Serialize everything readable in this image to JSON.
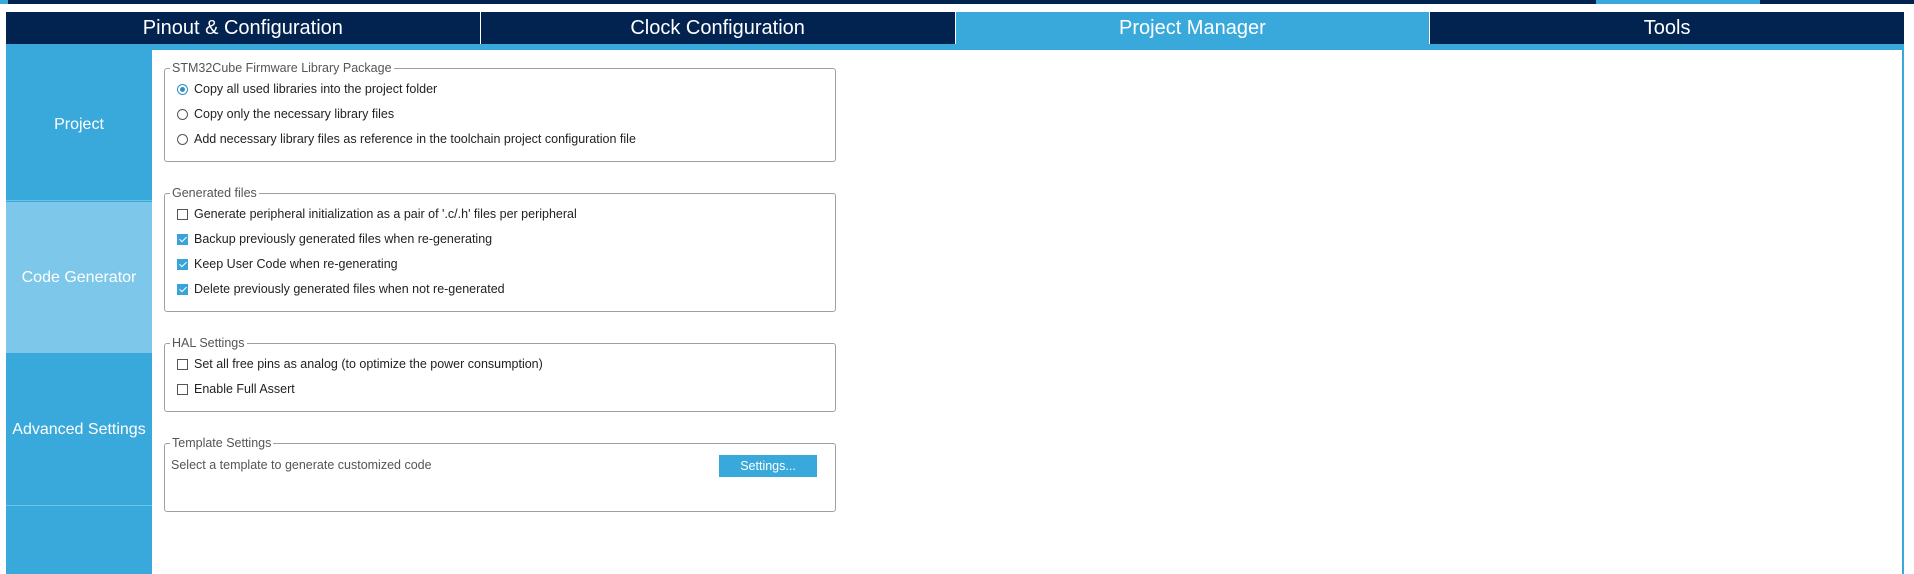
{
  "tabs": [
    {
      "label": "Pinout & Configuration"
    },
    {
      "label": "Clock Configuration"
    },
    {
      "label": "Project Manager"
    },
    {
      "label": "Tools"
    }
  ],
  "active_tab": "Project Manager",
  "sidebar": {
    "items": [
      {
        "label": "Project"
      },
      {
        "label": "Code Generator"
      },
      {
        "label": "Advanced Settings"
      },
      {
        "label": ""
      }
    ],
    "active": "Code Generator"
  },
  "firmware": {
    "legend": "STM32Cube Firmware Library Package",
    "options": [
      {
        "label": "Copy all used libraries into the project folder",
        "checked": true
      },
      {
        "label": "Copy only the necessary library files",
        "checked": false
      },
      {
        "label": "Add necessary library files as reference in the toolchain project configuration file",
        "checked": false
      }
    ]
  },
  "generated": {
    "legend": "Generated files",
    "options": [
      {
        "label": "Generate peripheral initialization as a pair of '.c/.h' files per peripheral",
        "checked": false
      },
      {
        "label": "Backup previously generated files when re-generating",
        "checked": true
      },
      {
        "label": "Keep User Code when re-generating",
        "checked": true
      },
      {
        "label": "Delete previously generated files when not re-generated",
        "checked": true
      }
    ]
  },
  "hal": {
    "legend": "HAL Settings",
    "options": [
      {
        "label": "Set all free pins as analog (to optimize the power consumption)",
        "checked": false
      },
      {
        "label": "Enable Full Assert",
        "checked": false
      }
    ]
  },
  "template": {
    "legend": "Template Settings",
    "description": "Select a template to generate customized code",
    "button_label": "Settings..."
  },
  "colors": {
    "navy": "#02234f",
    "accent": "#39a9dc",
    "sidebar_active": "#7dc8ea"
  }
}
